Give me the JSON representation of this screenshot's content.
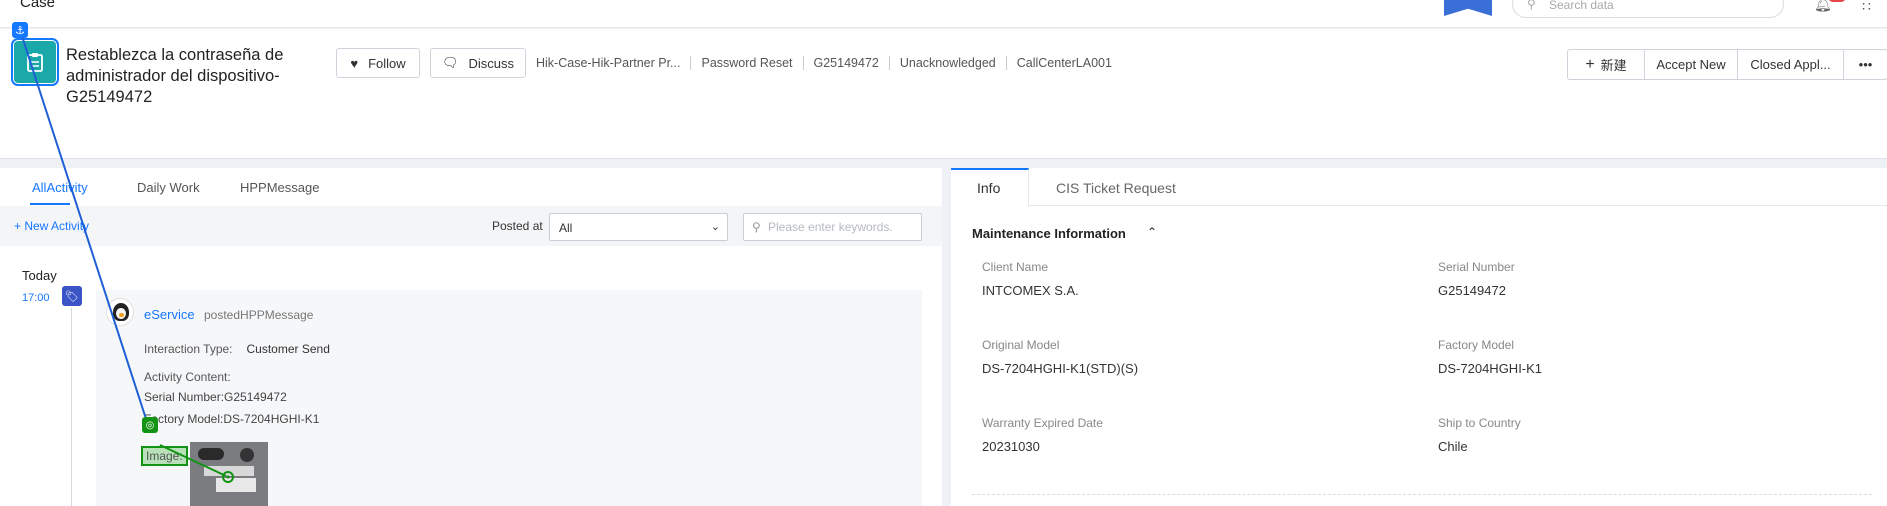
{
  "topbar": {
    "app_name": "Case",
    "search_placeholder": "Search data",
    "icons": {
      "search": "search-icon",
      "bell": "bell-icon",
      "apps": "grid-icon"
    }
  },
  "header": {
    "title": "Restablezca la contraseña de administrador del dispositivo-G25149472",
    "follow_label": "Follow",
    "discuss_label": "Discuss",
    "meta": [
      "Hik-Case-Hik-Partner Pr...",
      "Password Reset",
      "G25149472",
      "Unacknowledged",
      "CallCenterLA001"
    ],
    "actions": {
      "new_label": "新建",
      "accept_label": "Accept New",
      "closed_label": "Closed Appl...",
      "more_label": "•••"
    }
  },
  "activity_panel": {
    "tabs": [
      "AllActivity",
      "Daily Work",
      "HPPMessage"
    ],
    "active_tab": "AllActivity",
    "new_activity_label": "+ New Activity",
    "posted_at_label": "Posted at",
    "posted_at_value": "All",
    "keyword_placeholder": "Please enter keywords.",
    "day_label": "Today",
    "time_label": "17:00",
    "entry": {
      "author": "eService",
      "action": "postedHPPMessage",
      "interaction_type_label": "Interaction Type:",
      "interaction_type_value": "Customer Send",
      "content_label": "Activity Content:",
      "serial_line": "Serial Number:G25149472",
      "model_line": "Factory Model:DS-7204HGHI-K1",
      "image_label": "Image:"
    }
  },
  "info_panel": {
    "tabs": [
      "Info",
      "CIS Ticket Request"
    ],
    "active_tab": "Info",
    "section_title": "Maintenance Information",
    "fields": {
      "client_name": {
        "label": "Client Name",
        "value": "INTCOMEX S.A."
      },
      "serial_number": {
        "label": "Serial Number",
        "value": "G25149472"
      },
      "original_model": {
        "label": "Original Model",
        "value": "DS-7204HGHI-K1(STD)(S)"
      },
      "factory_model": {
        "label": "Factory Model",
        "value": "DS-7204HGHI-K1"
      },
      "warranty_expired": {
        "label": "Warranty Expired Date",
        "value": "20231030"
      },
      "ship_to_country": {
        "label": "Ship to Country",
        "value": "Chile"
      }
    }
  },
  "colors": {
    "accent": "#1677ff",
    "case_icon": "#1aa8a8",
    "tag": "#3b55c6",
    "annotation_line": "#1f5fd6",
    "annotation_target": "#139313"
  }
}
